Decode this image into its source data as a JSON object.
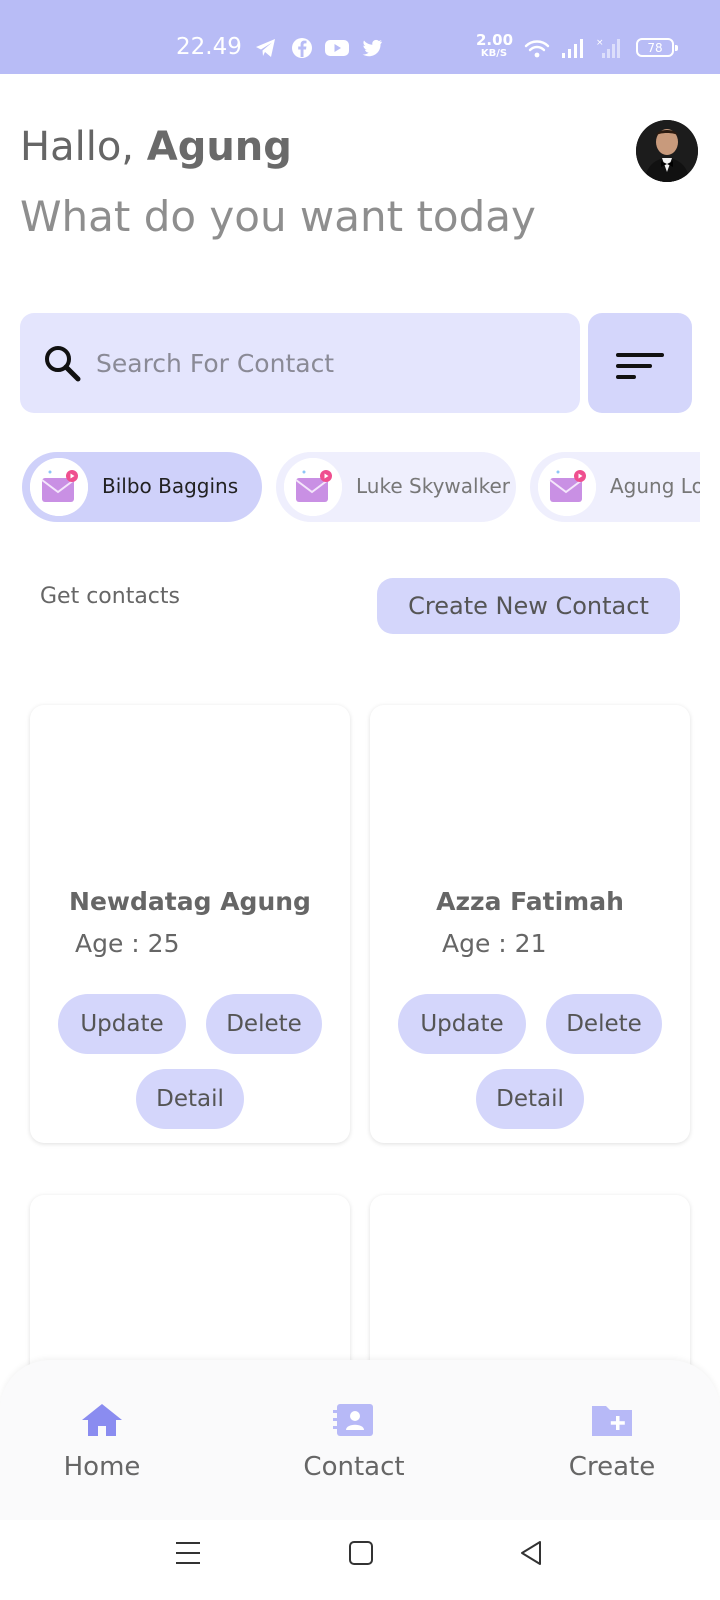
{
  "status_bar": {
    "time": "22.49",
    "net_speed_value": "2.00",
    "net_speed_unit": "KB/S",
    "battery": "78",
    "icons": [
      "telegram-icon",
      "facebook-icon",
      "youtube-icon",
      "twitter-icon",
      "wifi-icon",
      "signal-icon",
      "signal-icon-2",
      "battery-icon"
    ],
    "background_color": "#b8bcf6"
  },
  "header": {
    "greeting_prefix": "Hallo,",
    "user_name": "Agung",
    "subtitle": "What do you want today"
  },
  "search": {
    "placeholder": "Search For Contact",
    "value": ""
  },
  "chips": [
    {
      "label": "Bilbo Baggins",
      "active": true
    },
    {
      "label": "Luke Skywalker",
      "active": false
    },
    {
      "label": "Agung Lo",
      "active": false
    }
  ],
  "contacts_section": {
    "title": "Get contacts",
    "create_button": "Create New Contact"
  },
  "cards": [
    {
      "name": "Newdatag Agung",
      "age": "Age : 25",
      "update": "Update",
      "delete": "Delete",
      "detail": "Detail"
    },
    {
      "name": "Azza Fatimah",
      "age": "Age : 21",
      "update": "Update",
      "delete": "Delete",
      "detail": "Detail"
    }
  ],
  "bottom_nav": [
    {
      "label": "Home",
      "icon": "home-icon",
      "active": true
    },
    {
      "label": "Contact",
      "icon": "contact-card-icon",
      "active": false
    },
    {
      "label": "Create",
      "icon": "folder-plus-icon",
      "active": false
    }
  ],
  "colors": {
    "accent": "#d4d6fb",
    "search_bg": "#e4e5fd",
    "icon_active": "#8a8cf0",
    "icon_inactive": "#b7b9f7"
  }
}
